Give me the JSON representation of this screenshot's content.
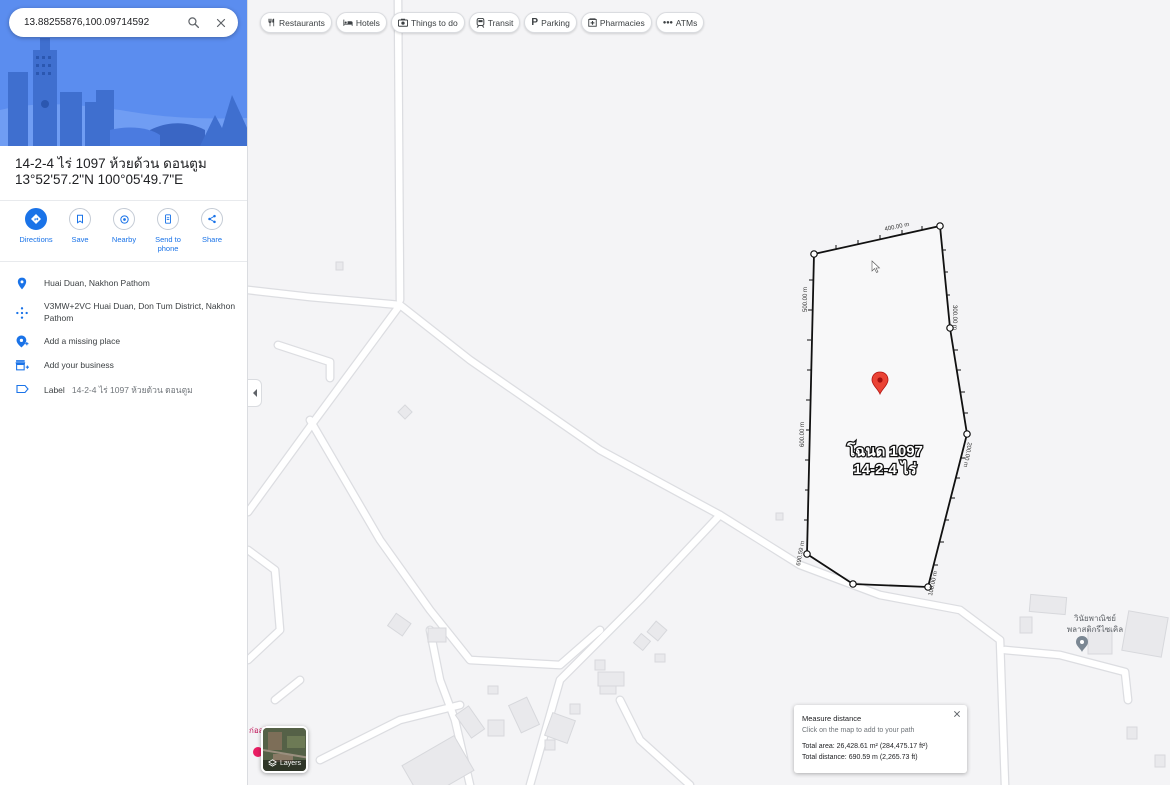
{
  "search": {
    "query": "13.88255876,100.09714592"
  },
  "place": {
    "title_line1": "14-2-4 ไร่ 1097 ห้วยด้วน ดอนตูม",
    "title_line2": "13°52'57.2\"N 100°05'49.7\"E"
  },
  "actions": [
    {
      "label": "Directions",
      "icon": "directions-icon"
    },
    {
      "label": "Save",
      "icon": "bookmark-icon"
    },
    {
      "label": "Nearby",
      "icon": "nearby-icon"
    },
    {
      "label": "Send to phone",
      "icon": "send-to-phone-icon"
    },
    {
      "label": "Share",
      "icon": "share-icon"
    }
  ],
  "info": {
    "location": "Huai Duan, Nakhon Pathom",
    "plus_code": "V3MW+2VC Huai Duan, Don Tum District, Nakhon Pathom",
    "add_missing_place": "Add a missing place",
    "add_business": "Add your business",
    "label_key": "Label",
    "label_value": "14-2-4 ไร่ 1097 ห้วยด้วน ดอนตูม"
  },
  "chips": [
    {
      "label": "Restaurants",
      "icon": "fork-knife-icon"
    },
    {
      "label": "Hotels",
      "icon": "bed-icon"
    },
    {
      "label": "Things to do",
      "icon": "camera-icon"
    },
    {
      "label": "Transit",
      "icon": "train-icon"
    },
    {
      "label": "Parking",
      "icon": "parking-icon"
    },
    {
      "label": "Pharmacies",
      "icon": "pharmacy-icon"
    },
    {
      "label": "ATMs",
      "icon": "atm-icon"
    }
  ],
  "map": {
    "plot_label_line1": "โฉนด 1097",
    "plot_label_line2": "14-2-4 ไร่",
    "segment_labels": [
      "400.00 m",
      "300.00 m",
      "200.00 m",
      "100.00 m",
      "500.00 m",
      "600.00 m",
      "690.59 m"
    ],
    "poi_name_line1": "วินัยพาณิชย์",
    "poi_name_line2": "พลาสติกรีไซเคิล",
    "partial_poi_left": "ก่อสร้าง",
    "colors": {
      "outline": "#111111",
      "pin": "#ea4335",
      "poi_pin": "#7b8793",
      "road": "#ffffff"
    }
  },
  "layers": {
    "label": "Layers"
  },
  "measure": {
    "title": "Measure distance",
    "hint": "Click on the map to add to your path",
    "area": "Total area: 26,428.61 m² (284,475.17 ft²)",
    "distance": "Total distance: 690.59 m (2,265.73 ft)"
  }
}
